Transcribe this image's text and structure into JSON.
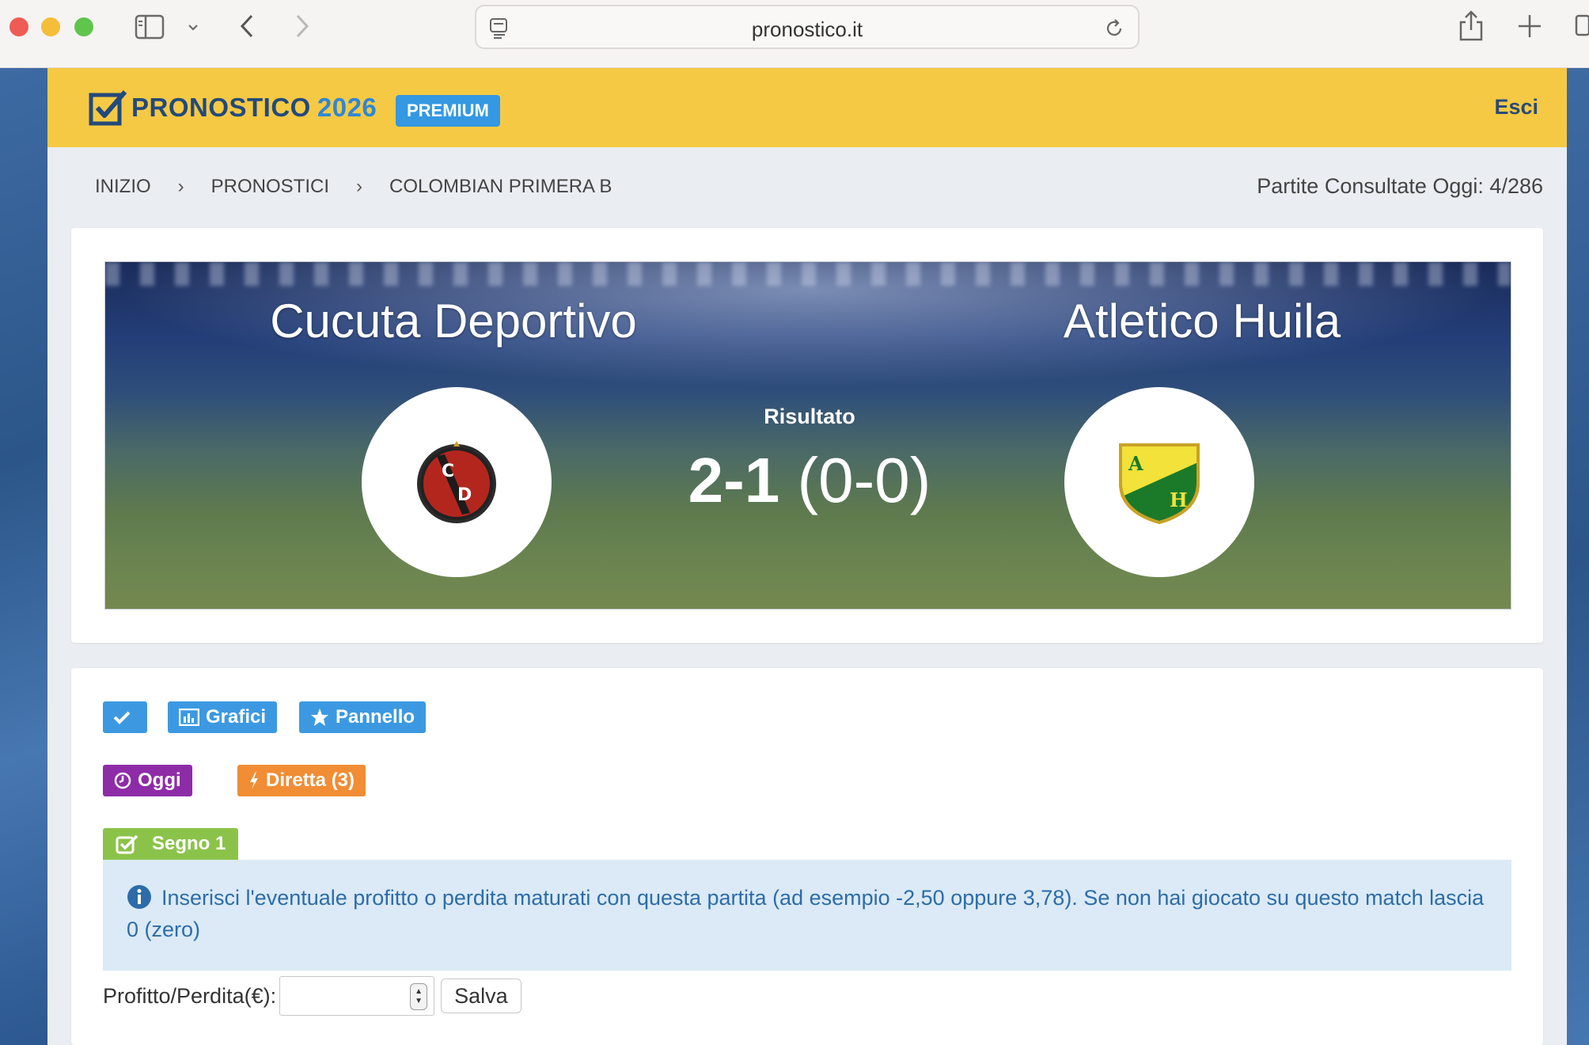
{
  "browser": {
    "url": "pronostico.it"
  },
  "header": {
    "logo_text": "PRONOSTICO",
    "logo_year": "2026",
    "premium_label": "PREMIUM",
    "logout_label": "Esci"
  },
  "breadcrumb": {
    "items": [
      "INIZIO",
      "PRONOSTICI",
      "COLOMBIAN PRIMERA B"
    ],
    "separator": "›"
  },
  "consulted_today": "Partite Consultate Oggi: 4/286",
  "match": {
    "home_team": "Cucuta Deportivo",
    "away_team": "Atletico Huila",
    "result_label": "Risultato",
    "score": "2-1",
    "halftime": "(0-0)"
  },
  "tools": {
    "grafici_label": "Grafici",
    "pannello_label": "Pannello",
    "oggi_label": "Oggi",
    "diretta_label": "Diretta (3)"
  },
  "prediction": {
    "label": "Segno 1",
    "info_text": "Inserisci l'eventuale profitto o perdita maturati con questa partita (ad esempio -2,50 oppure 3,78). Se non hai giocato su questo match lascia 0 (zero)",
    "profit_label": "Profitto/Perdita(€):",
    "profit_value": "",
    "save_label": "Salva"
  },
  "colors": {
    "header_bg": "#f6c944",
    "primary_blue": "#3c99e1",
    "purple": "#8e2ca8",
    "orange": "#f08d35",
    "green": "#8bc34a",
    "info_bg": "#dbeaf6",
    "info_text": "#2d6ca8"
  }
}
